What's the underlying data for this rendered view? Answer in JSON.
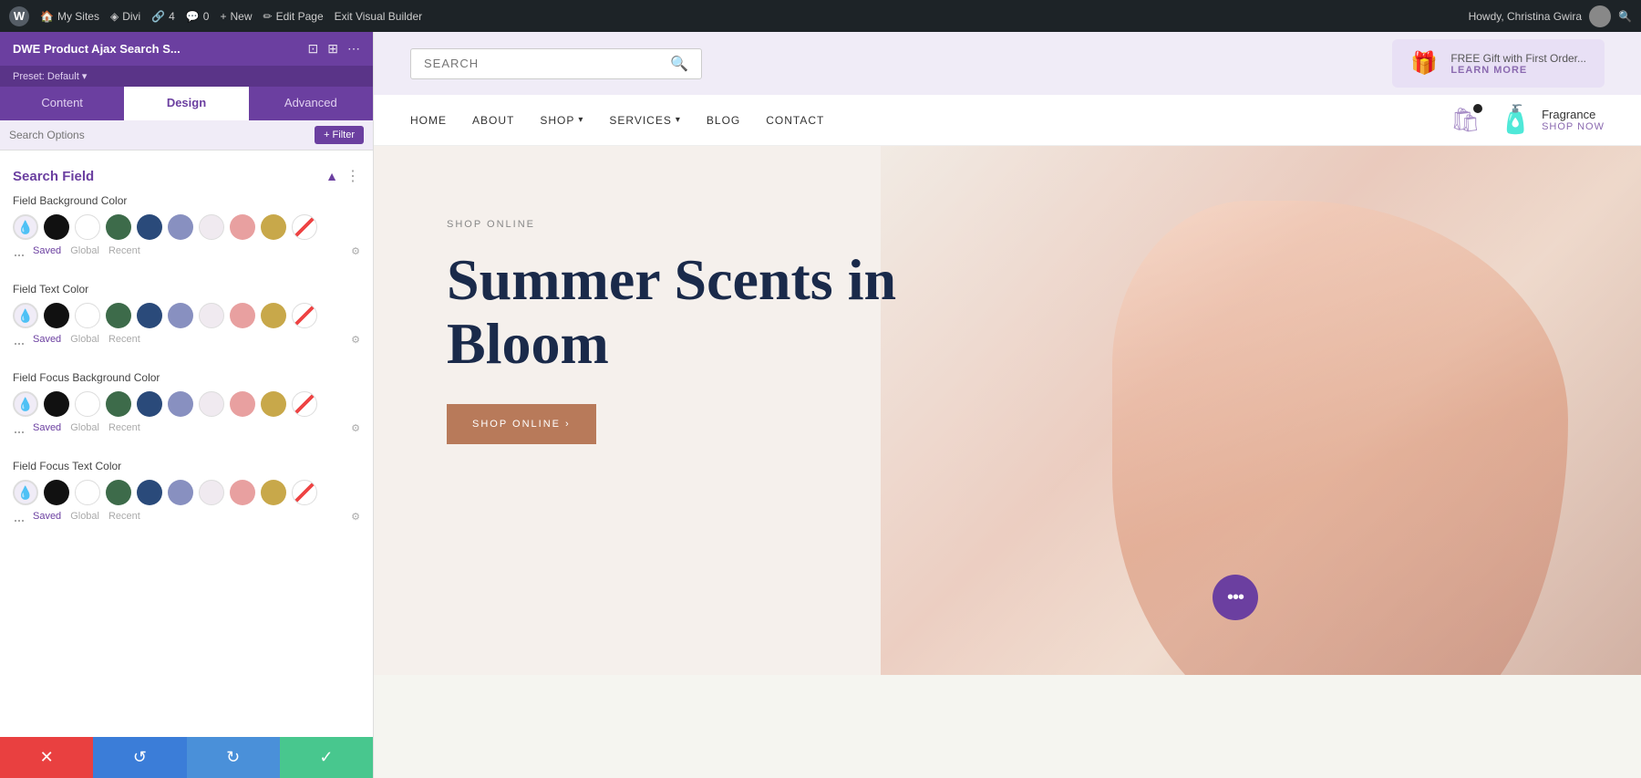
{
  "adminBar": {
    "wpIcon": "W",
    "items": [
      {
        "label": "My Sites",
        "icon": "🏠"
      },
      {
        "label": "Divi",
        "icon": "◈"
      },
      {
        "label": "4",
        "icon": "🔗"
      },
      {
        "label": "0",
        "icon": "💬"
      },
      {
        "label": "New",
        "icon": "+"
      },
      {
        "label": "Edit Page",
        "icon": "✏"
      },
      {
        "label": "Exit Visual Builder",
        "icon": ""
      }
    ],
    "userLabel": "Howdy, Christina Gwira",
    "searchIcon": "🔍"
  },
  "leftPanel": {
    "title": "DWE Product Ajax Search S...",
    "preset": "Preset: Default",
    "tabs": [
      {
        "label": "Content"
      },
      {
        "label": "Design",
        "active": true
      },
      {
        "label": "Advanced"
      }
    ],
    "searchOptions": {
      "placeholder": "Search Options",
      "filterBtn": "+ Filter"
    },
    "section": {
      "title": "Search Field",
      "colorGroups": [
        {
          "label": "Field Background Color",
          "colors": [
            {
              "type": "eyedropper",
              "color": "#f0ecf7"
            },
            {
              "type": "swatch",
              "color": "#111111"
            },
            {
              "type": "swatch",
              "color": "#ffffff"
            },
            {
              "type": "swatch",
              "color": "#3d6b4a"
            },
            {
              "type": "swatch",
              "color": "#2a4a7a"
            },
            {
              "type": "swatch",
              "color": "#8890c0"
            },
            {
              "type": "swatch",
              "color": "#f0eaf0"
            },
            {
              "type": "swatch",
              "color": "#e8a0a0"
            },
            {
              "type": "swatch",
              "color": "#c8a84a"
            },
            {
              "type": "strikethrough"
            }
          ],
          "tabs": [
            "Saved",
            "Global",
            "Recent"
          ],
          "activeTab": "Saved"
        },
        {
          "label": "Field Text Color",
          "colors": [
            {
              "type": "eyedropper",
              "color": "#f0ecf7"
            },
            {
              "type": "swatch",
              "color": "#111111"
            },
            {
              "type": "swatch",
              "color": "#ffffff"
            },
            {
              "type": "swatch",
              "color": "#3d6b4a"
            },
            {
              "type": "swatch",
              "color": "#2a4a7a"
            },
            {
              "type": "swatch",
              "color": "#8890c0"
            },
            {
              "type": "swatch",
              "color": "#f0eaf0"
            },
            {
              "type": "swatch",
              "color": "#e8a0a0"
            },
            {
              "type": "swatch",
              "color": "#c8a84a"
            },
            {
              "type": "strikethrough"
            }
          ],
          "tabs": [
            "Saved",
            "Global",
            "Recent"
          ],
          "activeTab": "Saved"
        },
        {
          "label": "Field Focus Background Color",
          "colors": [
            {
              "type": "eyedropper",
              "color": "#f0ecf7"
            },
            {
              "type": "swatch",
              "color": "#111111"
            },
            {
              "type": "swatch",
              "color": "#ffffff"
            },
            {
              "type": "swatch",
              "color": "#3d6b4a"
            },
            {
              "type": "swatch",
              "color": "#2a4a7a"
            },
            {
              "type": "swatch",
              "color": "#8890c0"
            },
            {
              "type": "swatch",
              "color": "#f0eaf0"
            },
            {
              "type": "swatch",
              "color": "#e8a0a0"
            },
            {
              "type": "swatch",
              "color": "#c8a84a"
            },
            {
              "type": "strikethrough"
            }
          ],
          "tabs": [
            "Saved",
            "Global",
            "Recent"
          ],
          "activeTab": "Saved"
        },
        {
          "label": "Field Focus Text Color",
          "colors": [
            {
              "type": "eyedropper",
              "color": "#f0ecf7"
            },
            {
              "type": "swatch",
              "color": "#111111"
            },
            {
              "type": "swatch",
              "color": "#ffffff"
            },
            {
              "type": "swatch",
              "color": "#3d6b4a"
            },
            {
              "type": "swatch",
              "color": "#2a4a7a"
            },
            {
              "type": "swatch",
              "color": "#8890c0"
            },
            {
              "type": "swatch",
              "color": "#f0eaf0"
            },
            {
              "type": "swatch",
              "color": "#e8a0a0"
            },
            {
              "type": "swatch",
              "color": "#c8a84a"
            },
            {
              "type": "strikethrough"
            }
          ],
          "tabs": [
            "Saved",
            "Global",
            "Recent"
          ],
          "activeTab": "Saved"
        }
      ]
    }
  },
  "bottomBar": {
    "cancel": "✕",
    "undo": "↺",
    "redo": "↻",
    "confirm": "✓"
  },
  "website": {
    "search": {
      "placeholder": "SEARCH"
    },
    "promo": {
      "icon": "🎁",
      "text": "FREE Gift with First Order...",
      "link": "LEARN MORE"
    },
    "nav": {
      "links": [
        {
          "label": "HOME"
        },
        {
          "label": "ABOUT"
        },
        {
          "label": "SHOP",
          "dropdown": true
        },
        {
          "label": "SERVICES",
          "dropdown": true
        },
        {
          "label": "BLOG"
        },
        {
          "label": "CONTACT"
        }
      ]
    },
    "fragrance": {
      "title": "Fragrance",
      "subtitle": "SHOP NOW"
    },
    "hero": {
      "tag": "SHOP ONLINE",
      "title": "Summer Scents in Bloom",
      "button": "SHOP ONLINE ›"
    },
    "fab": "•••"
  }
}
